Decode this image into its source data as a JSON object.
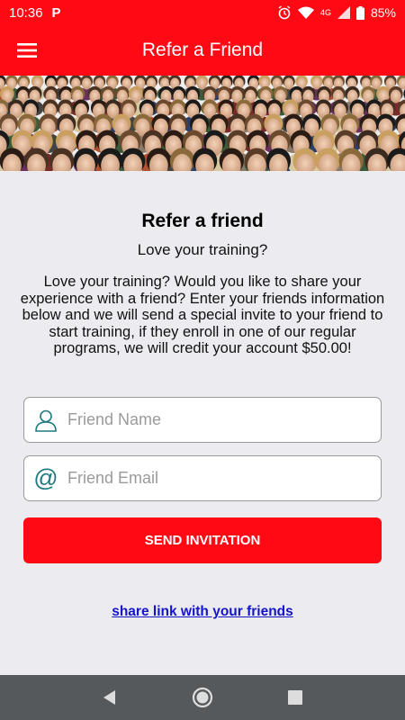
{
  "status_bar": {
    "time": "10:36",
    "app_indicator": "P",
    "network": "4G",
    "battery": "85%"
  },
  "app_bar": {
    "title": "Refer a Friend",
    "menu_icon": "hamburger-menu-icon"
  },
  "banner": {
    "icon": "crowd-photo"
  },
  "content": {
    "heading": "Refer a friend",
    "subheading": "Love your training?",
    "description": "Love your training? Would you like to share your experience with a friend? Enter your friends information below and we will send a special invite to your friend to start training, if they enroll in one of our regular programs, we will credit your account $50.00!"
  },
  "form": {
    "name_placeholder": "Friend Name",
    "name_value": "",
    "name_icon": "person-icon",
    "email_placeholder": "Friend Email",
    "email_value": "",
    "email_icon": "at-sign-icon",
    "submit_label": "SEND INVITATION"
  },
  "share_link": "share link with your friends",
  "colors": {
    "brand_red": "#ff0a14",
    "link_blue": "#1414c8",
    "icon_teal": "#1f7a80",
    "background": "#ebebf0",
    "nav_bar": "#55595c"
  },
  "nav": {
    "back_icon": "back-triangle-icon",
    "home_icon": "home-circle-icon",
    "recents_icon": "recents-square-icon"
  }
}
